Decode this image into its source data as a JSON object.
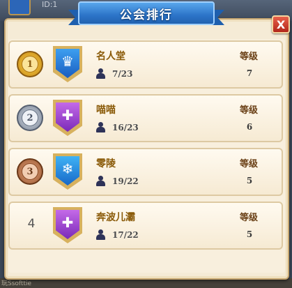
{
  "background": {
    "id_label": "ID:1",
    "bottom_text": "玩Ssofttie"
  },
  "panel": {
    "title": "公会排行",
    "close_label": "X"
  },
  "columns": {
    "level_label": "等级"
  },
  "guilds": [
    {
      "rank": "1",
      "name": "名人堂",
      "members": "7/23",
      "level": "7",
      "medal": "gold",
      "emblem": "crown",
      "emblem_color": "blue",
      "emblem_glyph": "♛"
    },
    {
      "rank": "2",
      "name": "喵喵",
      "members": "16/23",
      "level": "6",
      "medal": "silver",
      "emblem": "swords",
      "emblem_color": "purple",
      "emblem_glyph": "✚"
    },
    {
      "rank": "3",
      "name": "零陵",
      "members": "19/22",
      "level": "5",
      "medal": "bronze",
      "emblem": "snowflake",
      "emblem_color": "ice",
      "emblem_glyph": "❄"
    },
    {
      "rank": "4",
      "name": "奔波儿灞",
      "members": "17/22",
      "level": "5",
      "medal": "none",
      "emblem": "swords",
      "emblem_color": "purple",
      "emblem_glyph": "✚"
    }
  ],
  "icons": {
    "member": "person-icon",
    "medal": "medal-icon",
    "emblem": "guild-emblem-icon",
    "close": "close-icon"
  },
  "colors": {
    "ribbon": "#2c74c8",
    "guild_name": "#8a5a08",
    "close_button": "#c73a28"
  }
}
